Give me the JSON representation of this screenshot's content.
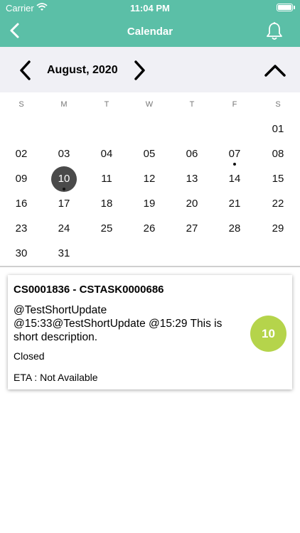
{
  "status_bar": {
    "carrier": "Carrier",
    "time": "11:04 PM"
  },
  "nav": {
    "title": "Calendar",
    "back_icon": "chevron-left-icon",
    "bell_icon": "bell-icon"
  },
  "calendar": {
    "month_label": "August, 2020",
    "weekdays": [
      "S",
      "M",
      "T",
      "W",
      "T",
      "F",
      "S"
    ],
    "weeks": [
      [
        "",
        "",
        "",
        "",
        "",
        "",
        "01"
      ],
      [
        "02",
        "03",
        "04",
        "05",
        "06",
        "07",
        "08"
      ],
      [
        "09",
        "10",
        "11",
        "12",
        "13",
        "14",
        "15"
      ],
      [
        "16",
        "17",
        "18",
        "19",
        "20",
        "21",
        "22"
      ],
      [
        "23",
        "24",
        "25",
        "26",
        "27",
        "28",
        "29"
      ],
      [
        "30",
        "31",
        "",
        "",
        "",
        "",
        ""
      ]
    ],
    "selected_day": "10",
    "event_days": [
      "07",
      "10"
    ]
  },
  "task": {
    "title": "CS0001836 - CSTASK0000686",
    "description": "@TestShortUpdate @15:33@TestShortUpdate @15:29 This is short description.",
    "status": "Closed",
    "eta": "ETA : Not Available",
    "day_badge": "10",
    "badge_color": "#b5d44b"
  },
  "colors": {
    "header": "#5bbfa7",
    "month_bar": "#f0f0f5",
    "selected_day": "#4a4a4a"
  }
}
